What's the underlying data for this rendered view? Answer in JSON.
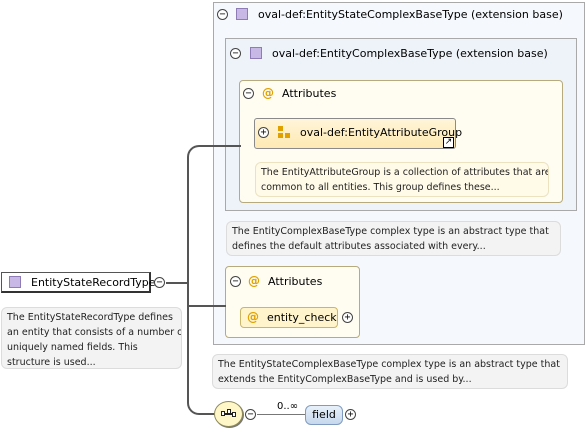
{
  "outer_type": {
    "label": "oval-def:EntityStateComplexBaseType (extension base)"
  },
  "inner_type": {
    "label": "oval-def:EntityComplexBaseType (extension base)"
  },
  "attributes_inner": {
    "label": "Attributes"
  },
  "attribute_group": {
    "label": "oval-def:EntityAttributeGroup",
    "note_lines": [
      "The EntityAttributeGroup is a collection of attributes that are",
      "common to all entities. This group defines these..."
    ]
  },
  "inner_type_note": {
    "lines": [
      "The EntityComplexBaseType complex type is an abstract type that",
      "defines the default attributes associated with every..."
    ]
  },
  "attributes_outer": {
    "label": "Attributes",
    "attribute": "entity_check"
  },
  "outer_type_note": {
    "lines": [
      "The EntityStateComplexBaseType complex type is an abstract type that",
      "extends the EntityComplexBaseType and is used by..."
    ]
  },
  "root": {
    "label": "EntityStateRecordType",
    "note_lines": [
      "The EntityStateRecordType defines",
      "an entity that consists of a number of",
      "uniquely named fields. This",
      "structure is used..."
    ]
  },
  "sequence": {
    "cardinality": "0..∞",
    "element": "field"
  }
}
